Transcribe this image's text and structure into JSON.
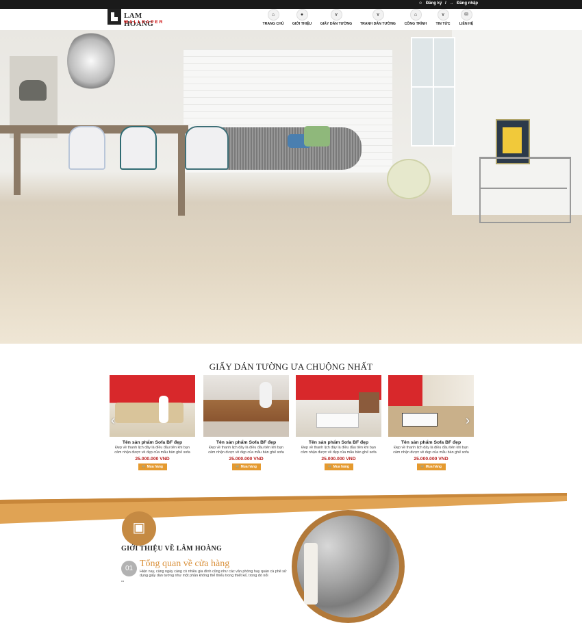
{
  "topbar": {
    "register": "Đăng ký",
    "separator": "/",
    "login": "Đăng nhập",
    "register_icon": "user-plus-icon",
    "login_icon": "login-icon"
  },
  "logo": {
    "brand": "LAM HOANG",
    "sub": "WALLPAPER"
  },
  "nav": {
    "items": [
      {
        "label": "TRANG CHỦ",
        "icon": "home-icon"
      },
      {
        "label": "GIỚI THIỆU",
        "icon": "user-icon"
      },
      {
        "label": "GIẤY DÁN TƯỜNG",
        "icon": "chevron-down-icon"
      },
      {
        "label": "TRANH DÁN TƯỜNG",
        "icon": "chevron-down-icon"
      },
      {
        "label": "CÔNG TRÌNH",
        "icon": "bank-icon"
      },
      {
        "label": "TIN TỨC",
        "icon": "chevron-down-icon"
      },
      {
        "label": "LIÊN HỆ",
        "icon": "envelope-icon"
      }
    ]
  },
  "featured": {
    "title": "GIẤY DÁN TƯỜNG ƯA CHUỘNG NHẤT",
    "products": [
      {
        "name": "Tên sản phẩm Sofa BF đẹp",
        "desc": "Đẹp về thanh lịch đây là điều đầu tiên khi bạn cảm nhận được về đẹp của mẫu bàn ghế sofa",
        "price": "25.000.000 VND",
        "buy": "Mua hàng"
      },
      {
        "name": "Tên sản phẩm Sofa BF đẹp",
        "desc": "Đẹp về thanh lịch đây là điều đầu tiên khi bạn cảm nhận được về đẹp của mẫu bàn ghế sofa",
        "price": "25.000.000 VND",
        "buy": "Mua hàng"
      },
      {
        "name": "Tên sản phẩm Sofa BF đẹp",
        "desc": "Đẹp về thanh lịch đây là điều đầu tiên khi bạn cảm nhận được về đẹp của mẫu bàn ghế sofa",
        "price": "25.000.000 VND",
        "buy": "Mua hàng"
      },
      {
        "name": "Tên sản phẩm Sofa BF đẹp",
        "desc": "Đẹp về thanh lịch đây là điều đầu tiên khi bạn cảm nhận được về đẹp của mẫu bàn ghế sofa",
        "price": "25.000.000 VND",
        "buy": "Mua hàng"
      }
    ]
  },
  "about": {
    "title": "GIỚI THIỆU VỀ LÂM HOÀNG",
    "icon": "contact-book-icon",
    "step_number": "01",
    "step_title": "Tổng quan về cửa hàng",
    "step_desc": "Hiện nay, càng ngày càng có nhiều gia đình cũng như các văn phòng hay quán cà phê sử dụng giấy dán tường như một phần không thể thiếu trong thiết kế, trong đó nổi"
  },
  "colors": {
    "accent": "#c58a43",
    "band": "#e0a354",
    "price": "#b71c1c",
    "buy_button": "#e59a2f",
    "topbar": "#1a1a1a"
  }
}
